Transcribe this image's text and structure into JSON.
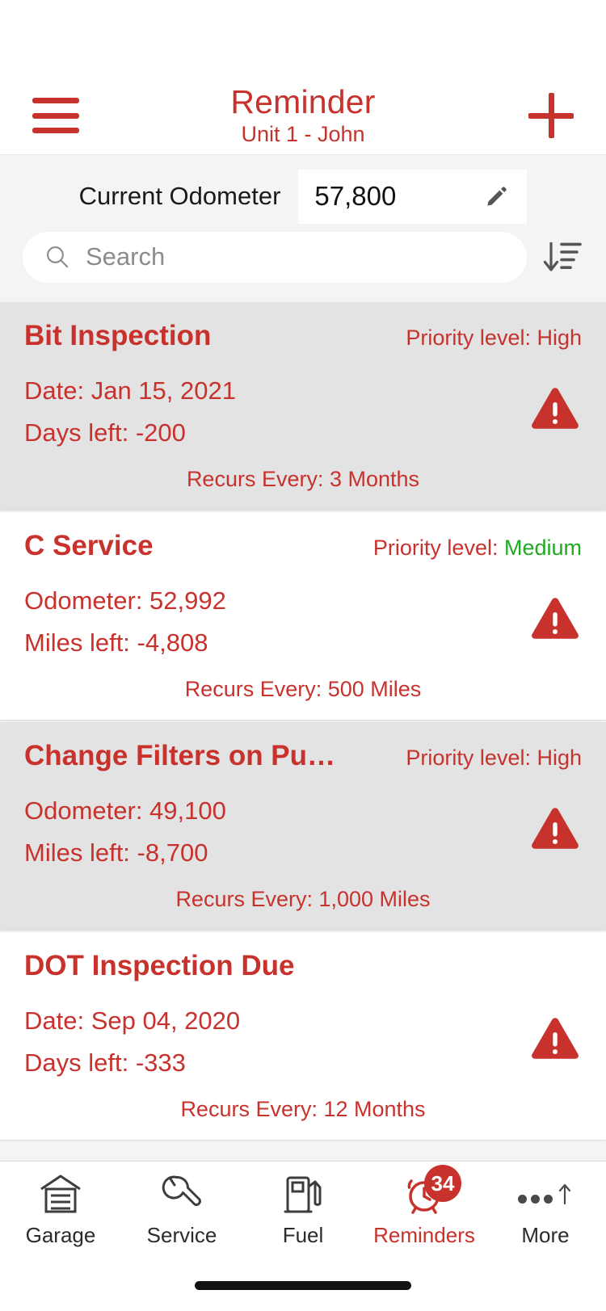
{
  "header": {
    "menu_icon": "hamburger-menu-icon",
    "title": "Reminder",
    "subtitle": "Unit 1 - John",
    "add_icon": "plus-icon"
  },
  "odometer": {
    "label": "Current Odometer",
    "value": "57,800",
    "edit_icon": "pencil-icon"
  },
  "search": {
    "placeholder": "Search",
    "icon": "search-icon",
    "sort_icon": "sort-descending-icon"
  },
  "colors": {
    "brand_red": "#c8322d",
    "priority_medium_green": "#1faa22",
    "card_gray": "#e3e3e3",
    "card_white": "#ffffff",
    "page_background": "#f4f4f4"
  },
  "reminders": [
    {
      "title": "Bit Inspection",
      "priority_label": "Priority level: ",
      "priority_value": "High",
      "priority_class": "pv-high",
      "line1": "Date: Jan 15, 2021",
      "line2": "Days left: -200",
      "recurs": "Recurs Every: 3 Months",
      "status_icon": "warning-triangle-icon",
      "background": "gray"
    },
    {
      "title": "C Service",
      "priority_label": "Priority level: ",
      "priority_value": "Medium",
      "priority_class": "pv-medium",
      "line1": "Odometer: 52,992",
      "line2": "Miles left: -4,808",
      "recurs": "Recurs Every: 500 Miles",
      "status_icon": "warning-triangle-icon",
      "background": "white"
    },
    {
      "title": "Change Filters on Pu…",
      "priority_label": "Priority level: ",
      "priority_value": "High",
      "priority_class": "pv-high",
      "line1": "Odometer: 49,100",
      "line2": "Miles left: -8,700",
      "recurs": "Recurs Every: 1,000 Miles",
      "status_icon": "warning-triangle-icon",
      "background": "gray"
    },
    {
      "title": "DOT Inspection Due",
      "priority_label": "",
      "priority_value": "",
      "priority_class": "pv-high",
      "line1": "Date: Sep 04, 2020",
      "line2": "Days left: -333",
      "recurs": "Recurs Every: 12 Months",
      "status_icon": "warning-triangle-icon",
      "background": "white"
    }
  ],
  "tabbar": [
    {
      "label": "Garage",
      "icon": "garage-icon",
      "active": false,
      "badge": ""
    },
    {
      "label": "Service",
      "icon": "wrench-icon",
      "active": false,
      "badge": ""
    },
    {
      "label": "Fuel",
      "icon": "fuel-pump-icon",
      "active": false,
      "badge": ""
    },
    {
      "label": "Reminders",
      "icon": "alarm-clock-icon",
      "active": true,
      "badge": "34"
    },
    {
      "label": "More",
      "icon": "more-icon",
      "active": false,
      "badge": ""
    }
  ]
}
